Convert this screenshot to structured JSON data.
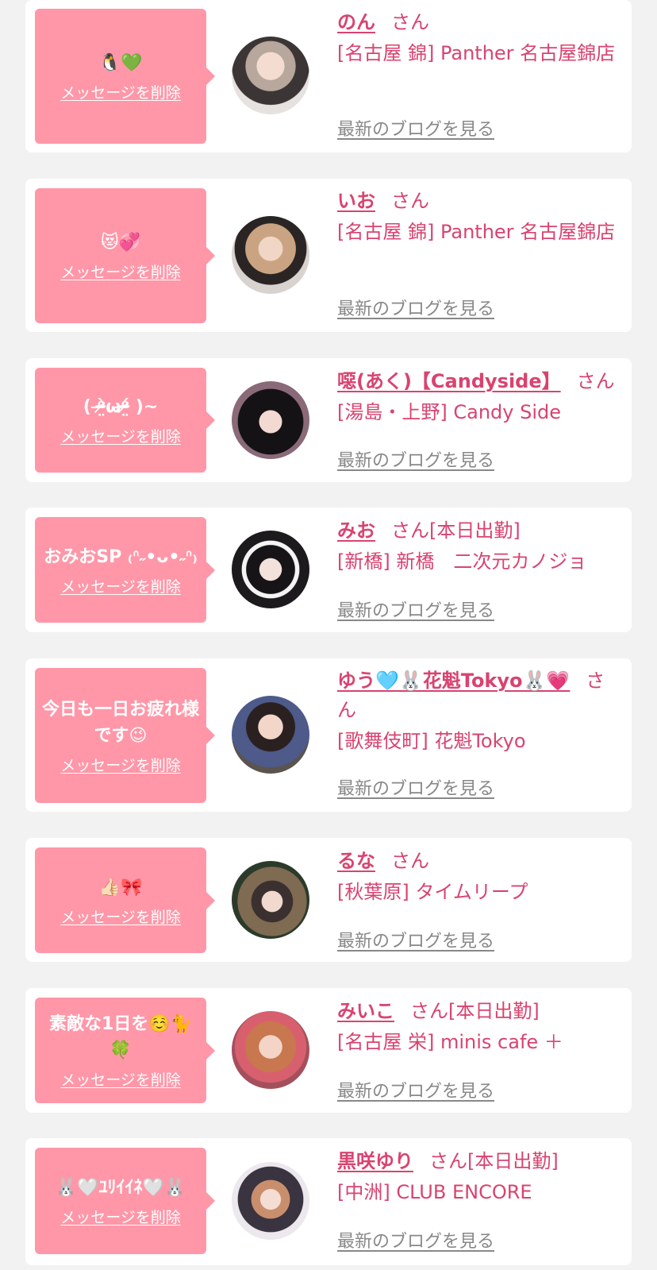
{
  "delete_label": "メッセージを削除",
  "blog_label": "最新のブログを見る",
  "honorific": "さん",
  "accent_color": "#ff97a8",
  "name_color": "#d9436f",
  "items": [
    {
      "message": "🐧💚",
      "name": "のん",
      "status": "",
      "shop": "[名古屋 錦] Panther 名古屋錦店"
    },
    {
      "message": "😻💞",
      "name": "いお",
      "status": "",
      "shop": "[名古屋 錦] Panther 名古屋錦店"
    },
    {
      "message": "( ᵒ̴̶̷̤̀ωᵒ̴̶̷̤́ )~",
      "name": "噁(あく)【Candyside】",
      "status": "",
      "shop": "[湯島・上野] Candy Side"
    },
    {
      "message": "おみおSP ₍ᐢ˶•ᴗ•˶ᐢ₎",
      "name": "みお",
      "status": "[本日出勤]",
      "shop": "[新橋] 新橋　二次元カノジョ"
    },
    {
      "message": "今日も一日お疲れ様です😉",
      "name": "ゆう🩵🐰花魁Tokyo🐰💗",
      "status": "",
      "shop": "[歌舞伎町] 花魁Tokyo"
    },
    {
      "message": "👍🏻🎀",
      "name": "るな",
      "status": "",
      "shop": "[秋葉原] タイムリープ"
    },
    {
      "message": "素敵な1日を☺️🐈🍀",
      "name": "みいこ",
      "status": "[本日出勤]",
      "shop": "[名古屋 栄] minis cafe ＋"
    },
    {
      "message": "🐰🤍ﾕﾘｲｲﾈ🤍🐰",
      "name": "黒咲ゆり",
      "status": "[本日出勤]",
      "shop": "[中洲] CLUB ENCORE"
    }
  ]
}
